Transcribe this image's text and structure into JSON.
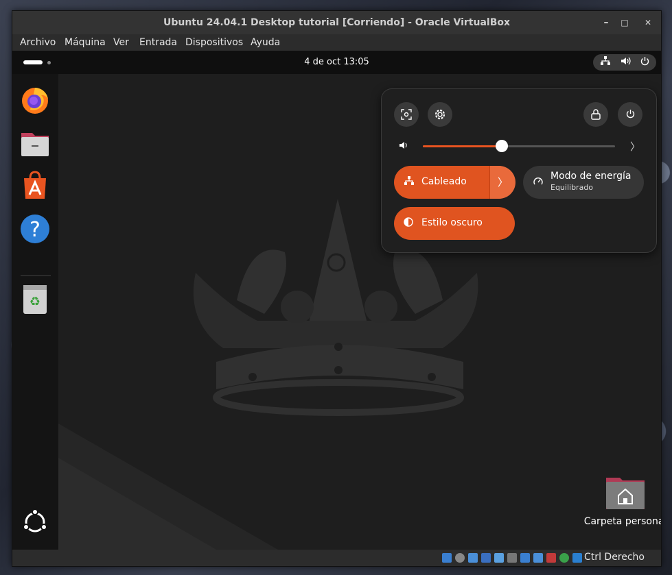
{
  "window": {
    "title": "Ubuntu 24.04.1 Desktop tutorial [Corriendo] - Oracle VirtualBox",
    "controls": {
      "minimize": "–",
      "maximize": "□",
      "close": "✕"
    }
  },
  "menu": [
    "Archivo",
    "Máquina",
    "Ver",
    "Entrada",
    "Dispositivos",
    "Ayuda"
  ],
  "topbar": {
    "clock": "4 de oct  13:05",
    "icons": [
      "network-icon",
      "volume-icon",
      "power-icon"
    ]
  },
  "dock": {
    "apps": [
      "firefox-icon",
      "files-icon",
      "app-center-icon",
      "help-icon",
      "trash-icon"
    ],
    "show_apps": "ubuntu-logo-icon",
    "help_glyph": "?"
  },
  "desktop": {
    "home_folder_label": "Carpeta personal"
  },
  "quick_settings": {
    "buttons": [
      "screenshot-icon",
      "settings-icon",
      "lock-icon",
      "power-icon"
    ],
    "volume": {
      "level": 0.41,
      "arrow": "〉"
    },
    "toggles": {
      "wired": {
        "label": "Cableado",
        "on": true,
        "arrow": "〉"
      },
      "power_mode": {
        "label": "Modo de energía",
        "sub": "Equilibrado",
        "on": false
      },
      "dark_style": {
        "label": "Estilo oscuro",
        "on": true
      }
    }
  },
  "statusbar": {
    "host_key": "Ctrl Derecho"
  },
  "colors": {
    "accent": "#e95420",
    "guest_bg": "#1e1e1e"
  }
}
